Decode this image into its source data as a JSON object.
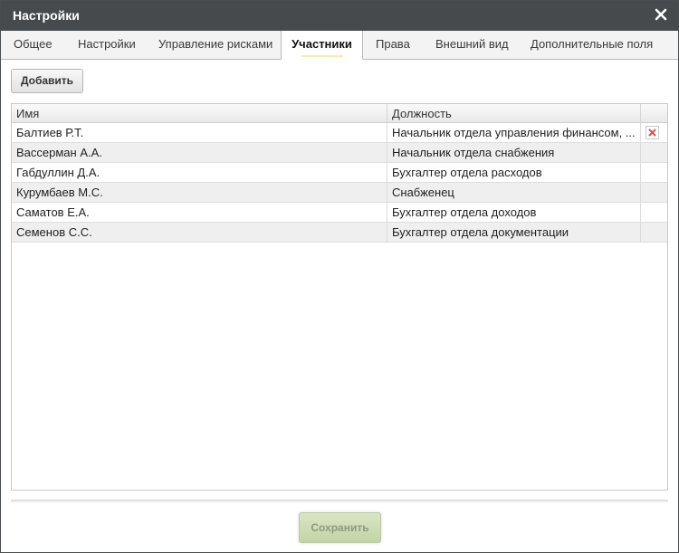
{
  "dialog": {
    "title": "Настройки"
  },
  "tabs": [
    {
      "label": "Общее",
      "active": false
    },
    {
      "label": "Настройки",
      "active": false
    },
    {
      "label": "Управление рисками",
      "active": false
    },
    {
      "label": "Участники",
      "active": true
    },
    {
      "label": "Права",
      "active": false
    },
    {
      "label": "Внешний вид",
      "active": false
    },
    {
      "label": "Дополнительные поля",
      "active": false
    }
  ],
  "toolbar": {
    "add_label": "Добавить"
  },
  "grid": {
    "columns": [
      "Имя",
      "Должность"
    ],
    "rows": [
      {
        "name": "Балтиев Р.Т.",
        "position": "Начальник отдела управления финансом, ..."
      },
      {
        "name": "Вассерман А.А.",
        "position": "Начальник отдела снабжения"
      },
      {
        "name": "Габдуллин Д.А.",
        "position": "Бухгалтер отдела расходов"
      },
      {
        "name": "Курумбаев М.С.",
        "position": "Снабженец"
      },
      {
        "name": "Саматов Е.А.",
        "position": "Бухгалтер отдела доходов"
      },
      {
        "name": "Семенов С.С.",
        "position": "Бухгалтер отдела документации"
      }
    ]
  },
  "footer": {
    "save_label": "Сохранить"
  },
  "icons": {
    "close": "close-icon",
    "delete": "delete-icon"
  },
  "colors": {
    "titlebar": "#474a4d",
    "save_button": "#c9dab0",
    "active_tab_accent": "#f4d53a",
    "delete_icon": "#d9534f"
  }
}
